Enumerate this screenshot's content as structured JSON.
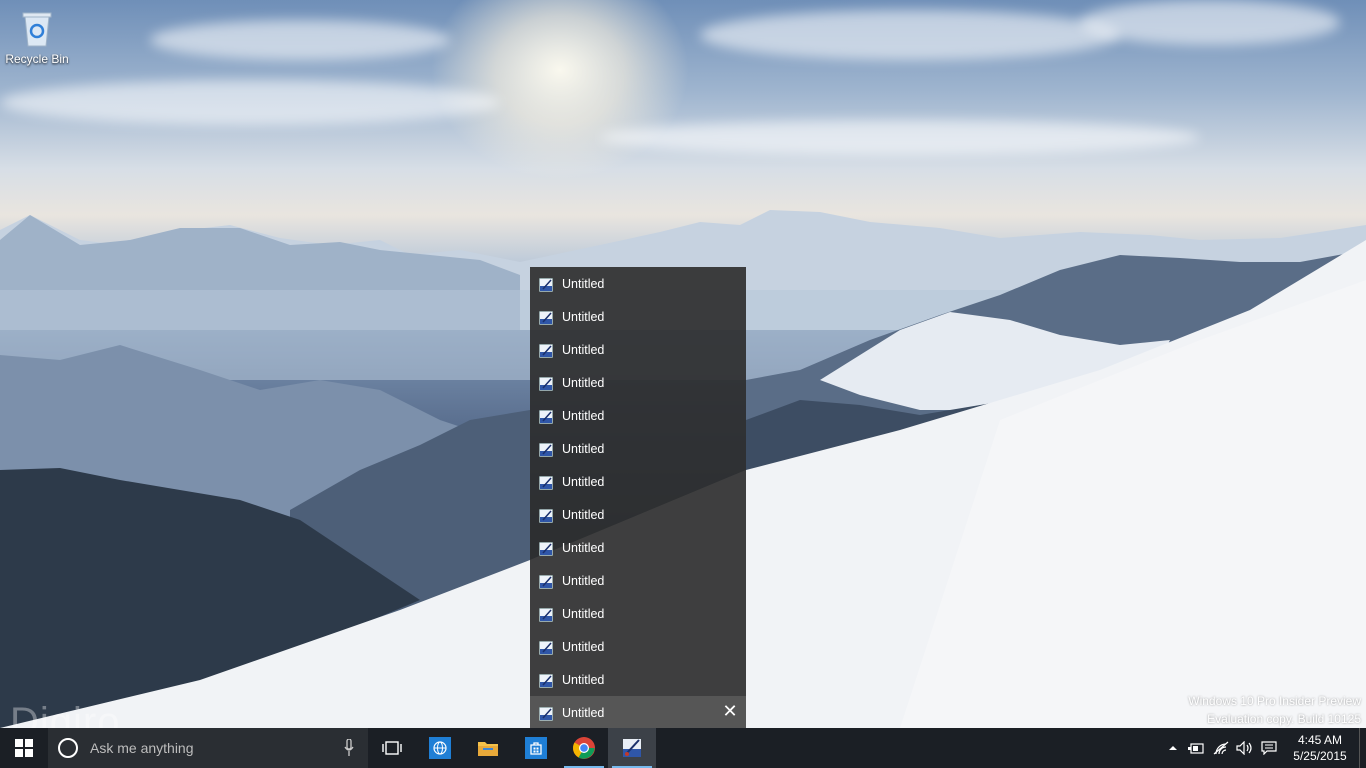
{
  "desktop": {
    "recycle_bin_label": "Recycle Bin",
    "watermark_line1": "Windows 10 Pro Insider Preview",
    "watermark_line2": "Evaluation copy. Build 10125",
    "brand_text": "Digiro"
  },
  "jumplist": {
    "items": [
      {
        "label": "Untitled"
      },
      {
        "label": "Untitled"
      },
      {
        "label": "Untitled"
      },
      {
        "label": "Untitled"
      },
      {
        "label": "Untitled"
      },
      {
        "label": "Untitled"
      },
      {
        "label": "Untitled"
      },
      {
        "label": "Untitled"
      },
      {
        "label": "Untitled"
      },
      {
        "label": "Untitled"
      },
      {
        "label": "Untitled"
      },
      {
        "label": "Untitled"
      },
      {
        "label": "Untitled"
      },
      {
        "label": "Untitled"
      }
    ],
    "close_glyph": "✕"
  },
  "taskbar": {
    "search_placeholder": "Ask me anything",
    "apps": [
      {
        "name": "task-view",
        "icon": "task-view-icon"
      },
      {
        "name": "internet-explorer",
        "icon": "globe-icon"
      },
      {
        "name": "file-explorer",
        "icon": "folder-icon"
      },
      {
        "name": "store",
        "icon": "store-icon"
      },
      {
        "name": "chrome",
        "icon": "chrome-icon"
      },
      {
        "name": "paint-app",
        "icon": "paint-icon"
      }
    ]
  },
  "tray": {
    "time": "4:45 AM",
    "date": "5/25/2015"
  },
  "colors": {
    "taskbar": "#1b1f25",
    "jumplist": "#2b2b2b",
    "accent": "#76b9ed"
  }
}
